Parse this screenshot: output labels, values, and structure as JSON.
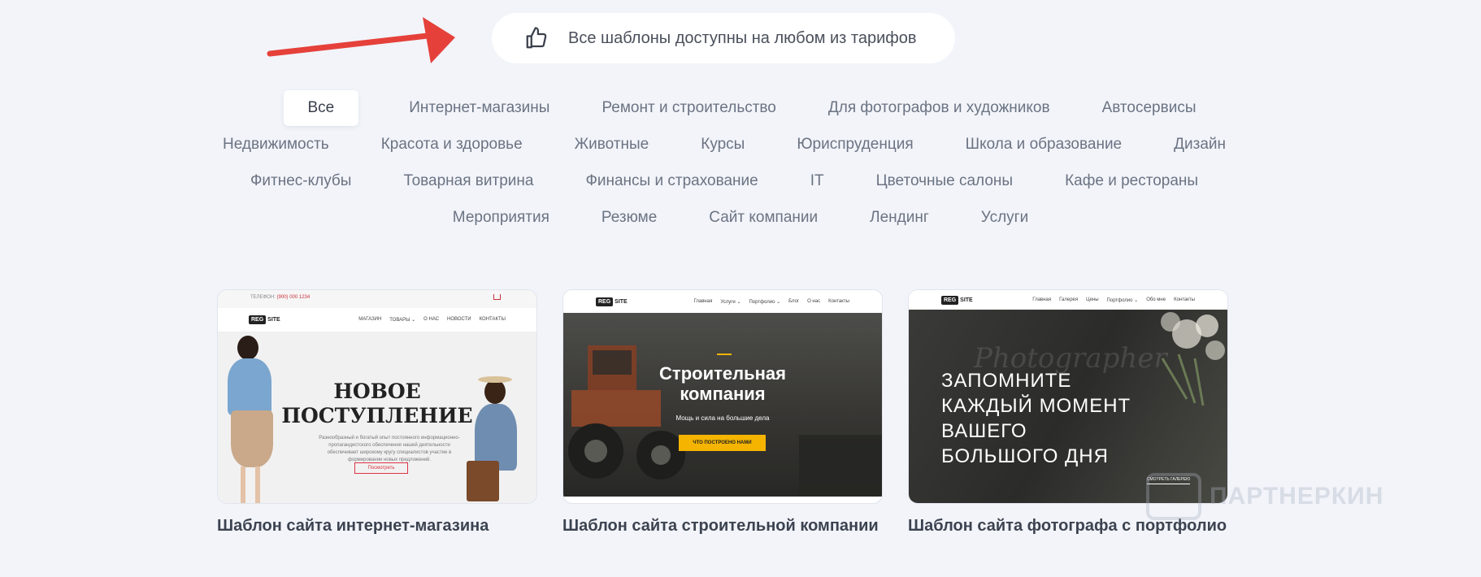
{
  "banner": {
    "text": "Все шаблоны доступны на любом из тарифов",
    "icon": "thumbs-up-icon",
    "arrow_color": "#e5413a"
  },
  "filters": {
    "rows": [
      [
        "Все",
        "Интернет-магазины",
        "Ремонт и строительство",
        "Для фотографов и художников",
        "Автосервисы"
      ],
      [
        "Недвижимость",
        "Красота и здоровье",
        "Животные",
        "Курсы",
        "Юриспруденция",
        "Школа и образование",
        "Дизайн"
      ],
      [
        "Фитнес-клубы",
        "Товарная витрина",
        "Финансы и страхование",
        "IT",
        "Цветочные салоны",
        "Кафе и рестораны"
      ],
      [
        "Мероприятия",
        "Резюме",
        "Сайт компании",
        "Лендинг",
        "Услуги"
      ]
    ],
    "active": "Все"
  },
  "cards": [
    {
      "title": "Шаблон сайта интернет-магазина",
      "preview": {
        "phone_label": "ТЕЛЕФОН: ",
        "phone": "(900) 000 1234",
        "logo_box": "REG",
        "logo_text": "SITE",
        "menu": [
          "МАГАЗИН",
          "ТОВАРЫ ⌄",
          "О НАС",
          "НОВОСТИ",
          "КОНТАКТЫ"
        ],
        "heading_line1": "НОВОЕ",
        "heading_line2": "ПОСТУПЛЕНИЕ",
        "subtext": "Разнообразный и богатый опыт постоянного информационно-пропагандистского обеспечения нашей деятельности обеспечивает широкому кругу специалистов участие в формировании новых предложений.",
        "button": "Посмотреть"
      }
    },
    {
      "title": "Шаблон сайта строительной компании",
      "preview": {
        "logo_box": "REG",
        "logo_text": "SITE",
        "menu": [
          "Главная",
          "Услуги ⌄",
          "Портфолио ⌄",
          "Блог",
          "О нас",
          "Контакты"
        ],
        "heading_line1": "Строительная",
        "heading_line2": "компания",
        "subtext": "Мощь и сила на большие дела",
        "button": "ЧТО ПОСТРОЕНО НАМИ",
        "accent": "#f4b400"
      }
    },
    {
      "title": "Шаблон сайта фотографа с портфолио",
      "preview": {
        "logo_box": "REG",
        "logo_text": "SITE",
        "menu": [
          "Главная",
          "Галерея",
          "Цены",
          "Портфолио ⌄",
          "Обо мне",
          "Контакты"
        ],
        "script": "Photographer",
        "heading_lines": [
          "ЗАПОМНИТЕ",
          "КАЖДЫЙ МОМЕНТ",
          "ВАШЕГО",
          "БОЛЬШОГО ДНЯ"
        ],
        "link": "СМОТРЕТЬ ГАЛЕРЕЮ"
      }
    }
  ],
  "watermark": "ПАРТНЕРКИН"
}
